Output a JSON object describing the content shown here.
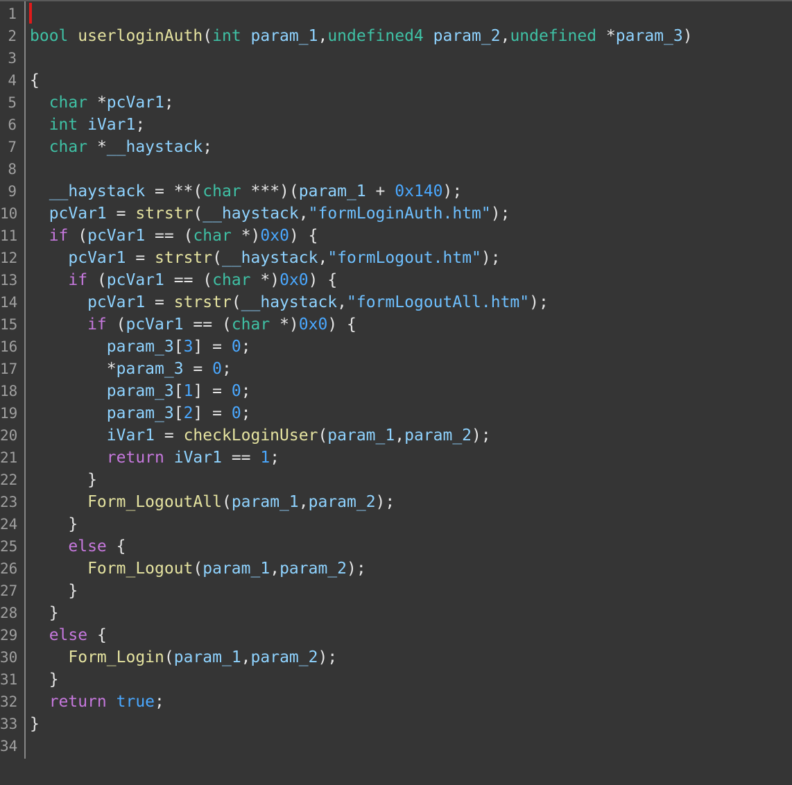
{
  "editor": {
    "line_numbers": [
      "1",
      "2",
      "3",
      "4",
      "5",
      "6",
      "7",
      "8",
      "9",
      "10",
      "11",
      "12",
      "13",
      "14",
      "15",
      "16",
      "17",
      "18",
      "19",
      "20",
      "21",
      "22",
      "23",
      "24",
      "25",
      "26",
      "27",
      "28",
      "29",
      "30",
      "31",
      "32",
      "33",
      "34"
    ],
    "lines": [
      [],
      [
        [
          "ty",
          "bool "
        ],
        [
          "fn",
          "userloginAuth"
        ],
        [
          "pl",
          "("
        ],
        [
          "ty",
          "int "
        ],
        [
          "id",
          "param_1"
        ],
        [
          "pl",
          ","
        ],
        [
          "ty",
          "undefined4 "
        ],
        [
          "id",
          "param_2"
        ],
        [
          "pl",
          ","
        ],
        [
          "ty",
          "undefined "
        ],
        [
          "pl",
          "*"
        ],
        [
          "id",
          "param_3"
        ],
        [
          "pl",
          ")"
        ]
      ],
      [],
      [
        [
          "pl",
          "{"
        ]
      ],
      [
        [
          "ty",
          "  char "
        ],
        [
          "pl",
          "*"
        ],
        [
          "id",
          "pcVar1"
        ],
        [
          "pl",
          ";"
        ]
      ],
      [
        [
          "ty",
          "  int "
        ],
        [
          "id",
          "iVar1"
        ],
        [
          "pl",
          ";"
        ]
      ],
      [
        [
          "ty",
          "  char "
        ],
        [
          "pl",
          "*"
        ],
        [
          "id",
          "__haystack"
        ],
        [
          "pl",
          ";"
        ]
      ],
      [],
      [
        [
          "id",
          "  __haystack"
        ],
        [
          "pl",
          " = **("
        ],
        [
          "ty",
          "char "
        ],
        [
          "pl",
          "***)("
        ],
        [
          "id",
          "param_1"
        ],
        [
          "pl",
          " + "
        ],
        [
          "num",
          "0x140"
        ],
        [
          "pl",
          ");"
        ]
      ],
      [
        [
          "id",
          "  pcVar1"
        ],
        [
          "pl",
          " = "
        ],
        [
          "fn",
          "strstr"
        ],
        [
          "pl",
          "("
        ],
        [
          "id",
          "__haystack"
        ],
        [
          "pl",
          ","
        ],
        [
          "str",
          "\"formLoginAuth.htm\""
        ],
        [
          "pl",
          ");"
        ]
      ],
      [
        [
          "kw",
          "  if "
        ],
        [
          "pl",
          "("
        ],
        [
          "id",
          "pcVar1"
        ],
        [
          "pl",
          " == ("
        ],
        [
          "ty",
          "char "
        ],
        [
          "pl",
          "*)"
        ],
        [
          "num",
          "0x0"
        ],
        [
          "pl",
          ") {"
        ]
      ],
      [
        [
          "id",
          "    pcVar1"
        ],
        [
          "pl",
          " = "
        ],
        [
          "fn",
          "strstr"
        ],
        [
          "pl",
          "("
        ],
        [
          "id",
          "__haystack"
        ],
        [
          "pl",
          ","
        ],
        [
          "str",
          "\"formLogout.htm\""
        ],
        [
          "pl",
          ");"
        ]
      ],
      [
        [
          "kw",
          "    if "
        ],
        [
          "pl",
          "("
        ],
        [
          "id",
          "pcVar1"
        ],
        [
          "pl",
          " == ("
        ],
        [
          "ty",
          "char "
        ],
        [
          "pl",
          "*)"
        ],
        [
          "num",
          "0x0"
        ],
        [
          "pl",
          ") {"
        ]
      ],
      [
        [
          "id",
          "      pcVar1"
        ],
        [
          "pl",
          " = "
        ],
        [
          "fn",
          "strstr"
        ],
        [
          "pl",
          "("
        ],
        [
          "id",
          "__haystack"
        ],
        [
          "pl",
          ","
        ],
        [
          "str",
          "\"formLogoutAll.htm\""
        ],
        [
          "pl",
          ");"
        ]
      ],
      [
        [
          "kw",
          "      if "
        ],
        [
          "pl",
          "("
        ],
        [
          "id",
          "pcVar1"
        ],
        [
          "pl",
          " == ("
        ],
        [
          "ty",
          "char "
        ],
        [
          "pl",
          "*)"
        ],
        [
          "num",
          "0x0"
        ],
        [
          "pl",
          ") {"
        ]
      ],
      [
        [
          "id",
          "        param_3"
        ],
        [
          "pl",
          "["
        ],
        [
          "num",
          "3"
        ],
        [
          "pl",
          "] = "
        ],
        [
          "num",
          "0"
        ],
        [
          "pl",
          ";"
        ]
      ],
      [
        [
          "pl",
          "        *"
        ],
        [
          "id",
          "param_3"
        ],
        [
          "pl",
          " = "
        ],
        [
          "num",
          "0"
        ],
        [
          "pl",
          ";"
        ]
      ],
      [
        [
          "id",
          "        param_3"
        ],
        [
          "pl",
          "["
        ],
        [
          "num",
          "1"
        ],
        [
          "pl",
          "] = "
        ],
        [
          "num",
          "0"
        ],
        [
          "pl",
          ";"
        ]
      ],
      [
        [
          "id",
          "        param_3"
        ],
        [
          "pl",
          "["
        ],
        [
          "num",
          "2"
        ],
        [
          "pl",
          "] = "
        ],
        [
          "num",
          "0"
        ],
        [
          "pl",
          ";"
        ]
      ],
      [
        [
          "id",
          "        iVar1"
        ],
        [
          "pl",
          " = "
        ],
        [
          "fn",
          "checkLoginUser"
        ],
        [
          "pl",
          "("
        ],
        [
          "id",
          "param_1"
        ],
        [
          "pl",
          ","
        ],
        [
          "id",
          "param_2"
        ],
        [
          "pl",
          ");"
        ]
      ],
      [
        [
          "kw",
          "        return "
        ],
        [
          "id",
          "iVar1"
        ],
        [
          "pl",
          " == "
        ],
        [
          "num",
          "1"
        ],
        [
          "pl",
          ";"
        ]
      ],
      [
        [
          "pl",
          "      }"
        ]
      ],
      [
        [
          "fn",
          "      Form_LogoutAll"
        ],
        [
          "pl",
          "("
        ],
        [
          "id",
          "param_1"
        ],
        [
          "pl",
          ","
        ],
        [
          "id",
          "param_2"
        ],
        [
          "pl",
          ");"
        ]
      ],
      [
        [
          "pl",
          "    }"
        ]
      ],
      [
        [
          "kw",
          "    else "
        ],
        [
          "pl",
          "{"
        ]
      ],
      [
        [
          "fn",
          "      Form_Logout"
        ],
        [
          "pl",
          "("
        ],
        [
          "id",
          "param_1"
        ],
        [
          "pl",
          ","
        ],
        [
          "id",
          "param_2"
        ],
        [
          "pl",
          ");"
        ]
      ],
      [
        [
          "pl",
          "    }"
        ]
      ],
      [
        [
          "pl",
          "  }"
        ]
      ],
      [
        [
          "kw",
          "  else "
        ],
        [
          "pl",
          "{"
        ]
      ],
      [
        [
          "fn",
          "    Form_Login"
        ],
        [
          "pl",
          "("
        ],
        [
          "id",
          "param_1"
        ],
        [
          "pl",
          ","
        ],
        [
          "id",
          "param_2"
        ],
        [
          "pl",
          ");"
        ]
      ],
      [
        [
          "pl",
          "  }"
        ]
      ],
      [
        [
          "kw",
          "  return "
        ],
        [
          "num",
          "true"
        ],
        [
          "pl",
          ";"
        ]
      ],
      [
        [
          "pl",
          "}"
        ]
      ],
      []
    ]
  }
}
